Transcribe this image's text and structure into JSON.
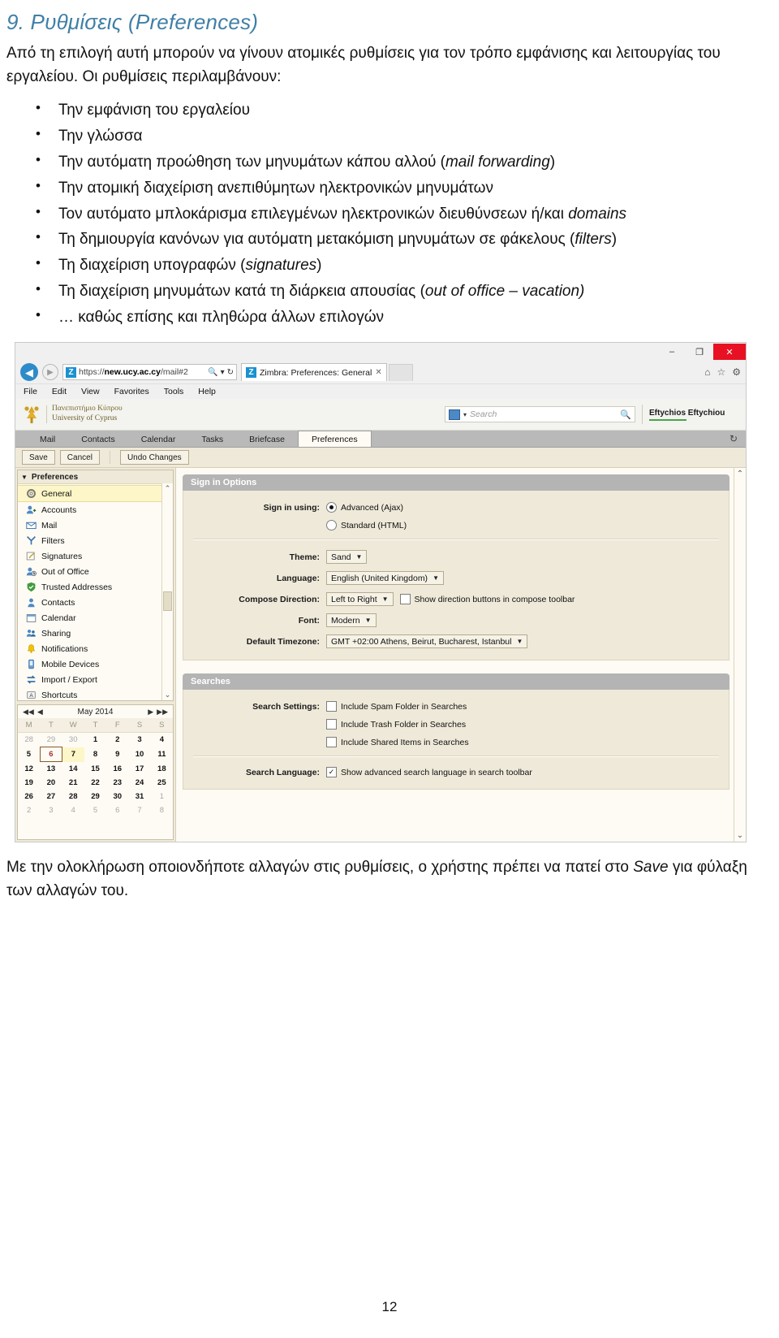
{
  "document": {
    "heading_number": "9.",
    "heading_text": "Ρυθμίσεις (Preferences)",
    "intro": "Από τη επιλογή αυτή μπορούν να γίνουν ατομικές ρυθμίσεις για τον τρόπο εμφάνισης και λειτουργίας του εργαλείου. Οι ρυθμίσεις περιλαμβάνουν:",
    "bullets": [
      {
        "text": "Την εμφάνιση του εργαλείου",
        "italic": ""
      },
      {
        "text": "Την γλώσσα",
        "italic": ""
      },
      {
        "text": "Την αυτόματη προώθηση των μηνυμάτων κάπου αλλού (",
        "italic": "mail forwarding",
        "after": ")"
      },
      {
        "text": "Την ατομική διαχείριση ανεπιθύμητων ηλεκτρονικών μηνυμάτων",
        "italic": ""
      },
      {
        "text": "Τον αυτόματο μπλοκάρισμα επιλεγμένων ηλεκτρονικών διευθύνσεων ή/και ",
        "italic": "domains",
        "after": ""
      },
      {
        "text": "Τη δημιουργία κανόνων για αυτόματη μετακόμιση μηνυμάτων σε φάκελους (",
        "italic": "filters",
        "after": ")"
      },
      {
        "text": "Τη διαχείριση υπογραφών (",
        "italic": "signatures",
        "after": ")"
      },
      {
        "text": "Τη διαχείριση μηνυμάτων κατά τη διάρκεια απουσίας (",
        "italic": "out of office – vacation)",
        "after": ""
      },
      {
        "text": "… καθώς επίσης και πληθώρα άλλων επιλογών",
        "italic": ""
      }
    ],
    "closing_1": "Με την ολοκλήρωση οποιονδήποτε αλλαγών στις ρυθμίσεις, ο χρήστης πρέπει να πατεί στο ",
    "closing_italic": "Save",
    "closing_2": " για φύλαξη των αλλαγών του.",
    "page_number": "12"
  },
  "browser": {
    "minimize_label": "–",
    "maximize_label": "❐",
    "close_label": "✕",
    "back_icon": "◀",
    "forward_icon": "▶",
    "url_prefix": "https://",
    "url_host": "new.ucy.ac.cy",
    "url_path": "/mail#2",
    "url_search_icon": "🔍",
    "url_caret": "▾",
    "url_refresh": "↻",
    "favicon_letter": "Z",
    "tab_title": "Zimbra: Preferences: General",
    "tab_close": "✕",
    "home_icon": "⌂",
    "favorites_icon": "☆",
    "settings_icon": "⚙",
    "menus": [
      "File",
      "Edit",
      "View",
      "Favorites",
      "Tools",
      "Help"
    ]
  },
  "zimbra": {
    "brand_line1": "Πανεπιστήμιο Κύπρου",
    "brand_line2": "University of Cyprus",
    "search_placeholder": "Search",
    "search_caret": "▾",
    "search_magnifier": "🔍",
    "user_name": "Eftychios Eftychiou",
    "user_caret": "▾",
    "app_tabs": [
      {
        "label": "Mail",
        "active": false
      },
      {
        "label": "Contacts",
        "active": false
      },
      {
        "label": "Calendar",
        "active": false
      },
      {
        "label": "Tasks",
        "active": false
      },
      {
        "label": "Briefcase",
        "active": false
      },
      {
        "label": "Preferences",
        "active": true
      }
    ],
    "refresh_icon": "↻",
    "toolbar": {
      "save_label": "Save",
      "cancel_label": "Cancel",
      "undo_label": "Undo Changes"
    },
    "tree": {
      "header": "Preferences",
      "expander": "▼",
      "items": [
        {
          "label": "General",
          "icon": "gear-icon",
          "selected": true
        },
        {
          "label": "Accounts",
          "icon": "accounts-icon",
          "selected": false
        },
        {
          "label": "Mail",
          "icon": "envelope-icon",
          "selected": false
        },
        {
          "label": "Filters",
          "icon": "filters-icon",
          "selected": false
        },
        {
          "label": "Signatures",
          "icon": "signature-icon",
          "selected": false
        },
        {
          "label": "Out of Office",
          "icon": "clock-icon",
          "selected": false
        },
        {
          "label": "Trusted Addresses",
          "icon": "shield-icon",
          "selected": false
        },
        {
          "label": "Contacts",
          "icon": "contact-icon",
          "selected": false
        },
        {
          "label": "Calendar",
          "icon": "calendar-icon",
          "selected": false
        },
        {
          "label": "Sharing",
          "icon": "sharing-icon",
          "selected": false
        },
        {
          "label": "Notifications",
          "icon": "bell-icon",
          "selected": false
        },
        {
          "label": "Mobile Devices",
          "icon": "phone-icon",
          "selected": false
        },
        {
          "label": "Import / Export",
          "icon": "import-export-icon",
          "selected": false
        },
        {
          "label": "Shortcuts",
          "icon": "shortcuts-icon",
          "selected": false
        }
      ],
      "scroll_up": "⌃",
      "scroll_down": "⌄"
    },
    "minical": {
      "first_icon": "◀◀",
      "prev_icon": "◀",
      "title": "May 2014",
      "next_icon": "▶",
      "last_icon": "▶▶",
      "weekday_headers": [
        "M",
        "T",
        "W",
        "T",
        "F",
        "S",
        "S"
      ],
      "weeks": [
        [
          {
            "d": "28",
            "o": true
          },
          {
            "d": "29",
            "o": true
          },
          {
            "d": "30",
            "o": true
          },
          {
            "d": "1"
          },
          {
            "d": "2"
          },
          {
            "d": "3"
          },
          {
            "d": "4"
          }
        ],
        [
          {
            "d": "5"
          },
          {
            "d": "6",
            "today": true
          },
          {
            "d": "7",
            "sel": true
          },
          {
            "d": "8"
          },
          {
            "d": "9"
          },
          {
            "d": "10"
          },
          {
            "d": "11"
          }
        ],
        [
          {
            "d": "12"
          },
          {
            "d": "13"
          },
          {
            "d": "14"
          },
          {
            "d": "15"
          },
          {
            "d": "16"
          },
          {
            "d": "17"
          },
          {
            "d": "18"
          }
        ],
        [
          {
            "d": "19"
          },
          {
            "d": "20"
          },
          {
            "d": "21"
          },
          {
            "d": "22"
          },
          {
            "d": "23"
          },
          {
            "d": "24"
          },
          {
            "d": "25"
          }
        ],
        [
          {
            "d": "26"
          },
          {
            "d": "27"
          },
          {
            "d": "28"
          },
          {
            "d": "29"
          },
          {
            "d": "30"
          },
          {
            "d": "31"
          },
          {
            "d": "1",
            "o": true
          }
        ],
        [
          {
            "d": "2",
            "o": true
          },
          {
            "d": "3",
            "o": true
          },
          {
            "d": "4",
            "o": true
          },
          {
            "d": "5",
            "o": true
          },
          {
            "d": "6",
            "o": true
          },
          {
            "d": "7",
            "o": true
          },
          {
            "d": "8",
            "o": true
          }
        ]
      ]
    },
    "signin_panel": {
      "title": "Sign in Options",
      "signin_label": "Sign in using:",
      "option_advanced": "Advanced (Ajax)",
      "option_standard": "Standard (HTML)",
      "theme_label": "Theme:",
      "theme_value": "Sand",
      "language_label": "Language:",
      "language_value": "English (United Kingdom)",
      "compose_direction_label": "Compose Direction:",
      "compose_direction_value": "Left to Right",
      "show_direction_buttons": "Show direction buttons in compose toolbar",
      "font_label": "Font:",
      "font_value": "Modern",
      "timezone_label": "Default Timezone:",
      "timezone_value": "GMT +02:00 Athens, Beirut, Bucharest, Istanbul"
    },
    "searches_panel": {
      "title": "Searches",
      "search_settings_label": "Search Settings:",
      "opt_spam": "Include Spam Folder in Searches",
      "opt_trash": "Include Trash Folder in Searches",
      "opt_shared": "Include Shared Items in Searches",
      "search_language_label": "Search Language:",
      "opt_advanced_language": "Show advanced search language in search toolbar",
      "advanced_checked": "✓"
    },
    "scroll_up": "⌃",
    "scroll_down": "⌄"
  },
  "colors": {
    "heading": "#3f7fa6",
    "zimbra_blue": "#1a91d0",
    "panel_header": "#b4b4b4",
    "panel_body": "#efe9d9",
    "selected_row": "#fdf6c8",
    "close_red": "#e81123",
    "user_underline": "#4aa34a"
  }
}
